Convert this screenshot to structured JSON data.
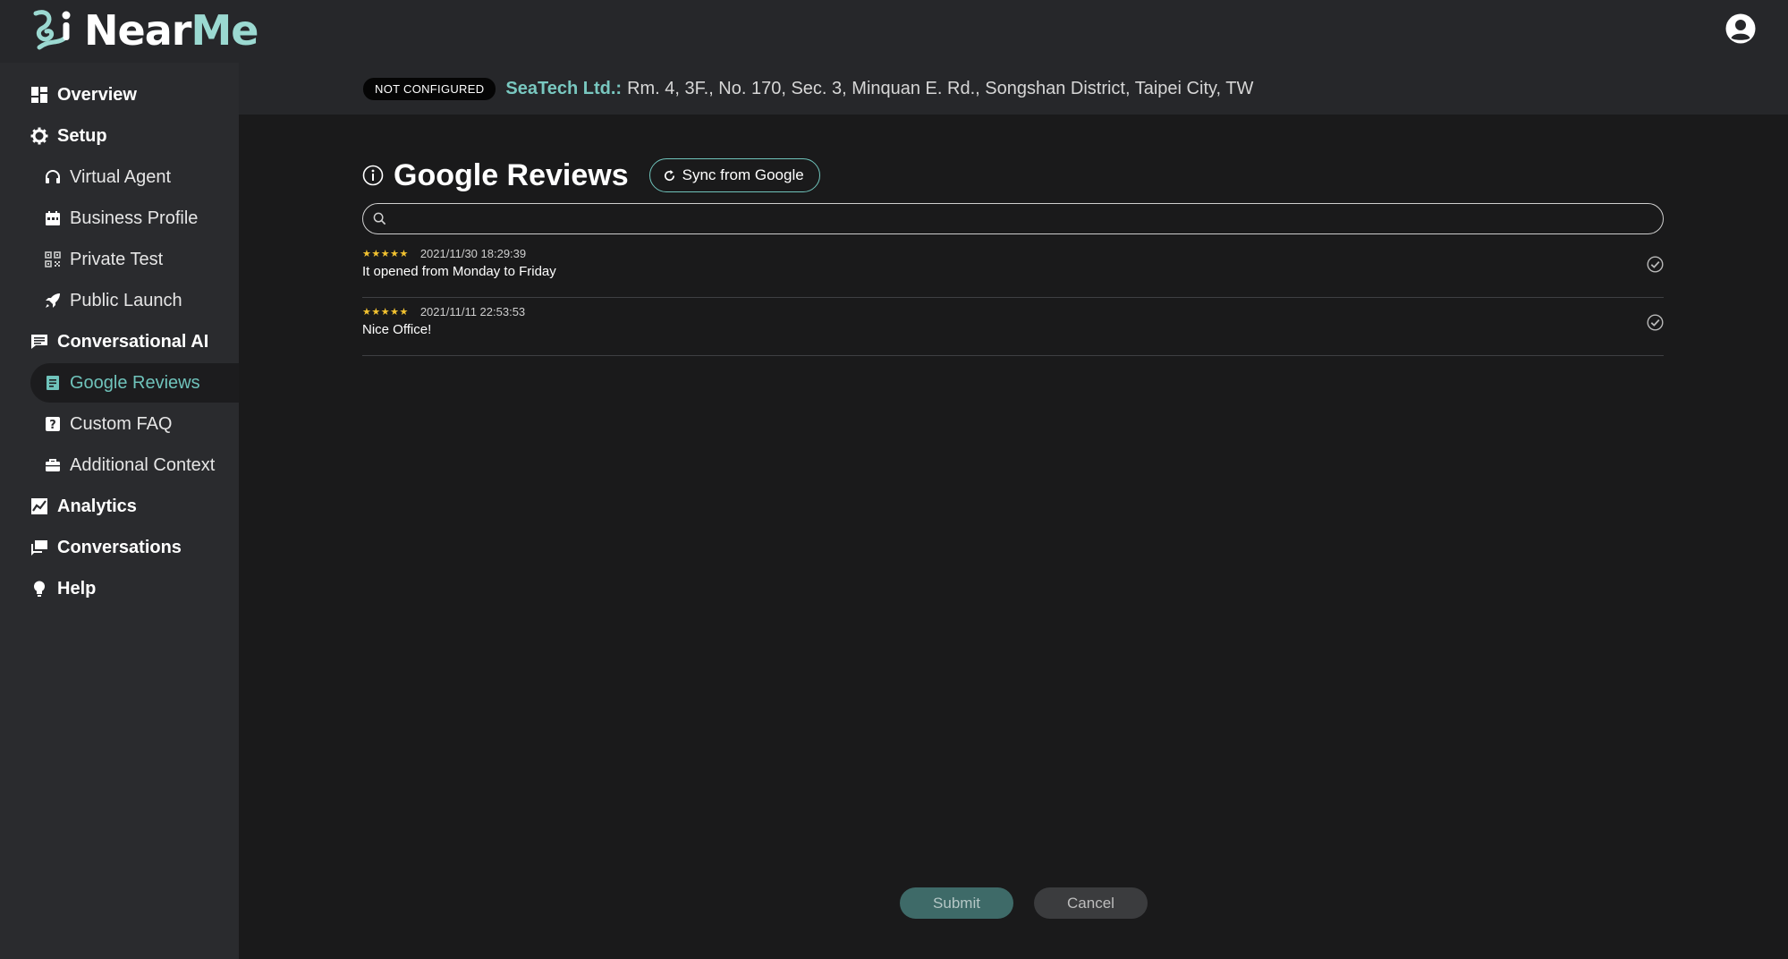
{
  "app": {
    "logo_near": "Near",
    "logo_me": "Me",
    "accent_color": "#6fc3bb",
    "account_icon": "user-circle-icon"
  },
  "sidebar": {
    "items": [
      {
        "label": "Overview",
        "icon": "dashboard-icon",
        "level": "top"
      },
      {
        "label": "Setup",
        "icon": "gear-icon",
        "level": "top"
      },
      {
        "label": "Virtual Agent",
        "icon": "headset-icon",
        "level": "sub"
      },
      {
        "label": "Business Profile",
        "icon": "calendar-icon",
        "level": "sub"
      },
      {
        "label": "Private Test",
        "icon": "qr-code-icon",
        "level": "sub"
      },
      {
        "label": "Public Launch",
        "icon": "rocket-icon",
        "level": "sub"
      },
      {
        "label": "Conversational AI",
        "icon": "message-icon",
        "level": "top"
      },
      {
        "label": "Google Reviews",
        "icon": "reviews-icon",
        "level": "sub",
        "active": true
      },
      {
        "label": "Custom FAQ",
        "icon": "question-icon",
        "level": "sub"
      },
      {
        "label": "Additional Context",
        "icon": "briefcase-icon",
        "level": "sub"
      },
      {
        "label": "Analytics",
        "icon": "chart-icon",
        "level": "top"
      },
      {
        "label": "Conversations",
        "icon": "chat-icon",
        "level": "top"
      },
      {
        "label": "Help",
        "icon": "lightbulb-icon",
        "level": "top"
      }
    ]
  },
  "header": {
    "status_badge": "NOT CONFIGURED",
    "business_name": "SeaTech Ltd.:",
    "business_address": "Rm. 4, 3F., No. 170, Sec. 3, Minquan E. Rd., Songshan District, Taipei City, TW"
  },
  "main": {
    "title": "Google Reviews",
    "sync_label": "Sync from Google",
    "search_placeholder": "",
    "search_value": "",
    "reviews": [
      {
        "stars": "★★★★★",
        "rating": 5,
        "date": "2021/11/30 18:29:39",
        "text": "It opened from Monday to Friday",
        "checked": true
      },
      {
        "stars": "★★★★★",
        "rating": 5,
        "date": "2021/11/11 22:53:53",
        "text": "Nice Office!",
        "checked": true
      }
    ],
    "submit_label": "Submit",
    "cancel_label": "Cancel"
  }
}
